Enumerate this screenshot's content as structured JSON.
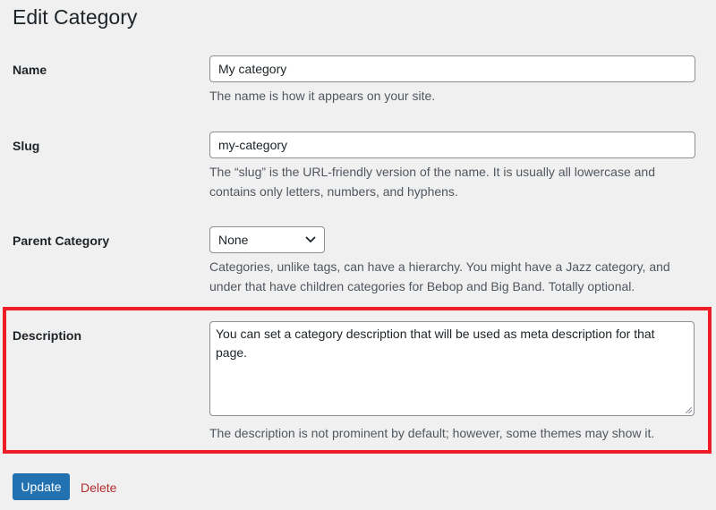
{
  "title": "Edit Category",
  "fields": {
    "name": {
      "label": "Name",
      "value": "My category",
      "help": "The name is how it appears on your site."
    },
    "slug": {
      "label": "Slug",
      "value": "my-category",
      "help": "The “slug” is the URL-friendly version of the name. It is usually all lowercase and contains only letters, numbers, and hyphens."
    },
    "parent": {
      "label": "Parent Category",
      "value": "None",
      "help": "Categories, unlike tags, can have a hierarchy. You might have a Jazz category, and under that have children categories for Bebop and Big Band. Totally optional."
    },
    "description": {
      "label": "Description",
      "value": "You can set a category description that will be used as meta description for that page.",
      "help": "The description is not prominent by default; however, some themes may show it."
    }
  },
  "actions": {
    "update": "Update",
    "delete": "Delete"
  },
  "colors": {
    "highlight": "#ee1c25",
    "primary": "#2271b1",
    "delete": "#b32d2e"
  }
}
